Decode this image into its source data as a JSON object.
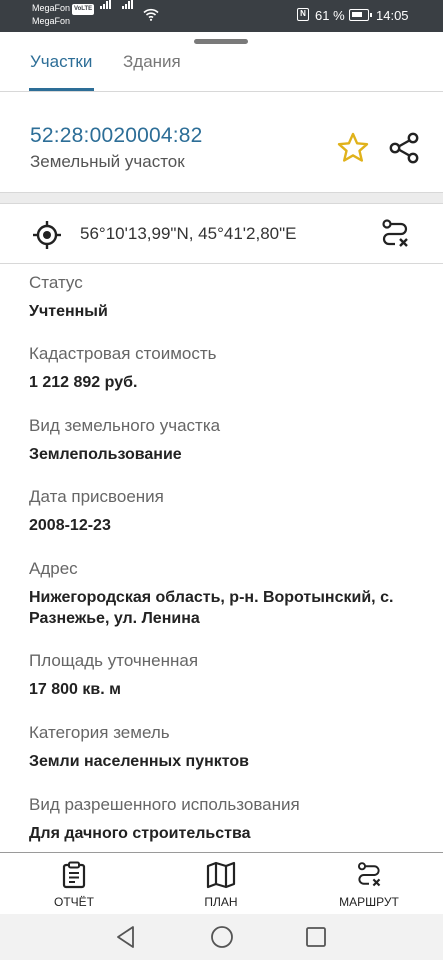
{
  "status_bar": {
    "carrier_1": "MegaFon",
    "carrier_1_badge": "VoLTE",
    "carrier_2": "MegaFon",
    "nfc_label": "N",
    "battery": "61 %",
    "time": "14:05"
  },
  "tabs": [
    {
      "label": "Участки",
      "active": true
    },
    {
      "label": "Здания",
      "active": false
    }
  ],
  "object": {
    "cadastral_number": "52:28:0020004:82",
    "type": "Земельный участок",
    "coordinates": "56°10'13,99\"N, 45°41'2,80\"E"
  },
  "fields": [
    {
      "label": "Статус",
      "value": "Учтенный"
    },
    {
      "label": "Кадастровая стоимость",
      "value": "1 212 892 руб."
    },
    {
      "label": "Вид земельного участка",
      "value": "Землепользование"
    },
    {
      "label": "Дата присвоения",
      "value": "2008-12-23"
    },
    {
      "label": "Адрес",
      "value": "Нижегородская область, р-н. Воротынский, с. Разнежье, ул. Ленина"
    },
    {
      "label": "Площадь уточненная",
      "value": "17 800 кв. м"
    },
    {
      "label": "Категория земель",
      "value": "Земли населенных пунктов"
    },
    {
      "label": "Вид разрешенного использования",
      "value": "Для дачного строительства"
    }
  ],
  "bottom_nav": [
    {
      "label": "ОТЧЁТ",
      "icon": "report-icon"
    },
    {
      "label": "ПЛАН",
      "icon": "map-icon"
    },
    {
      "label": "МАРШРУТ",
      "icon": "route-icon"
    }
  ],
  "colors": {
    "accent": "#2d6e97",
    "star": "#e0b21b",
    "status_bar": "#3a3f44"
  }
}
